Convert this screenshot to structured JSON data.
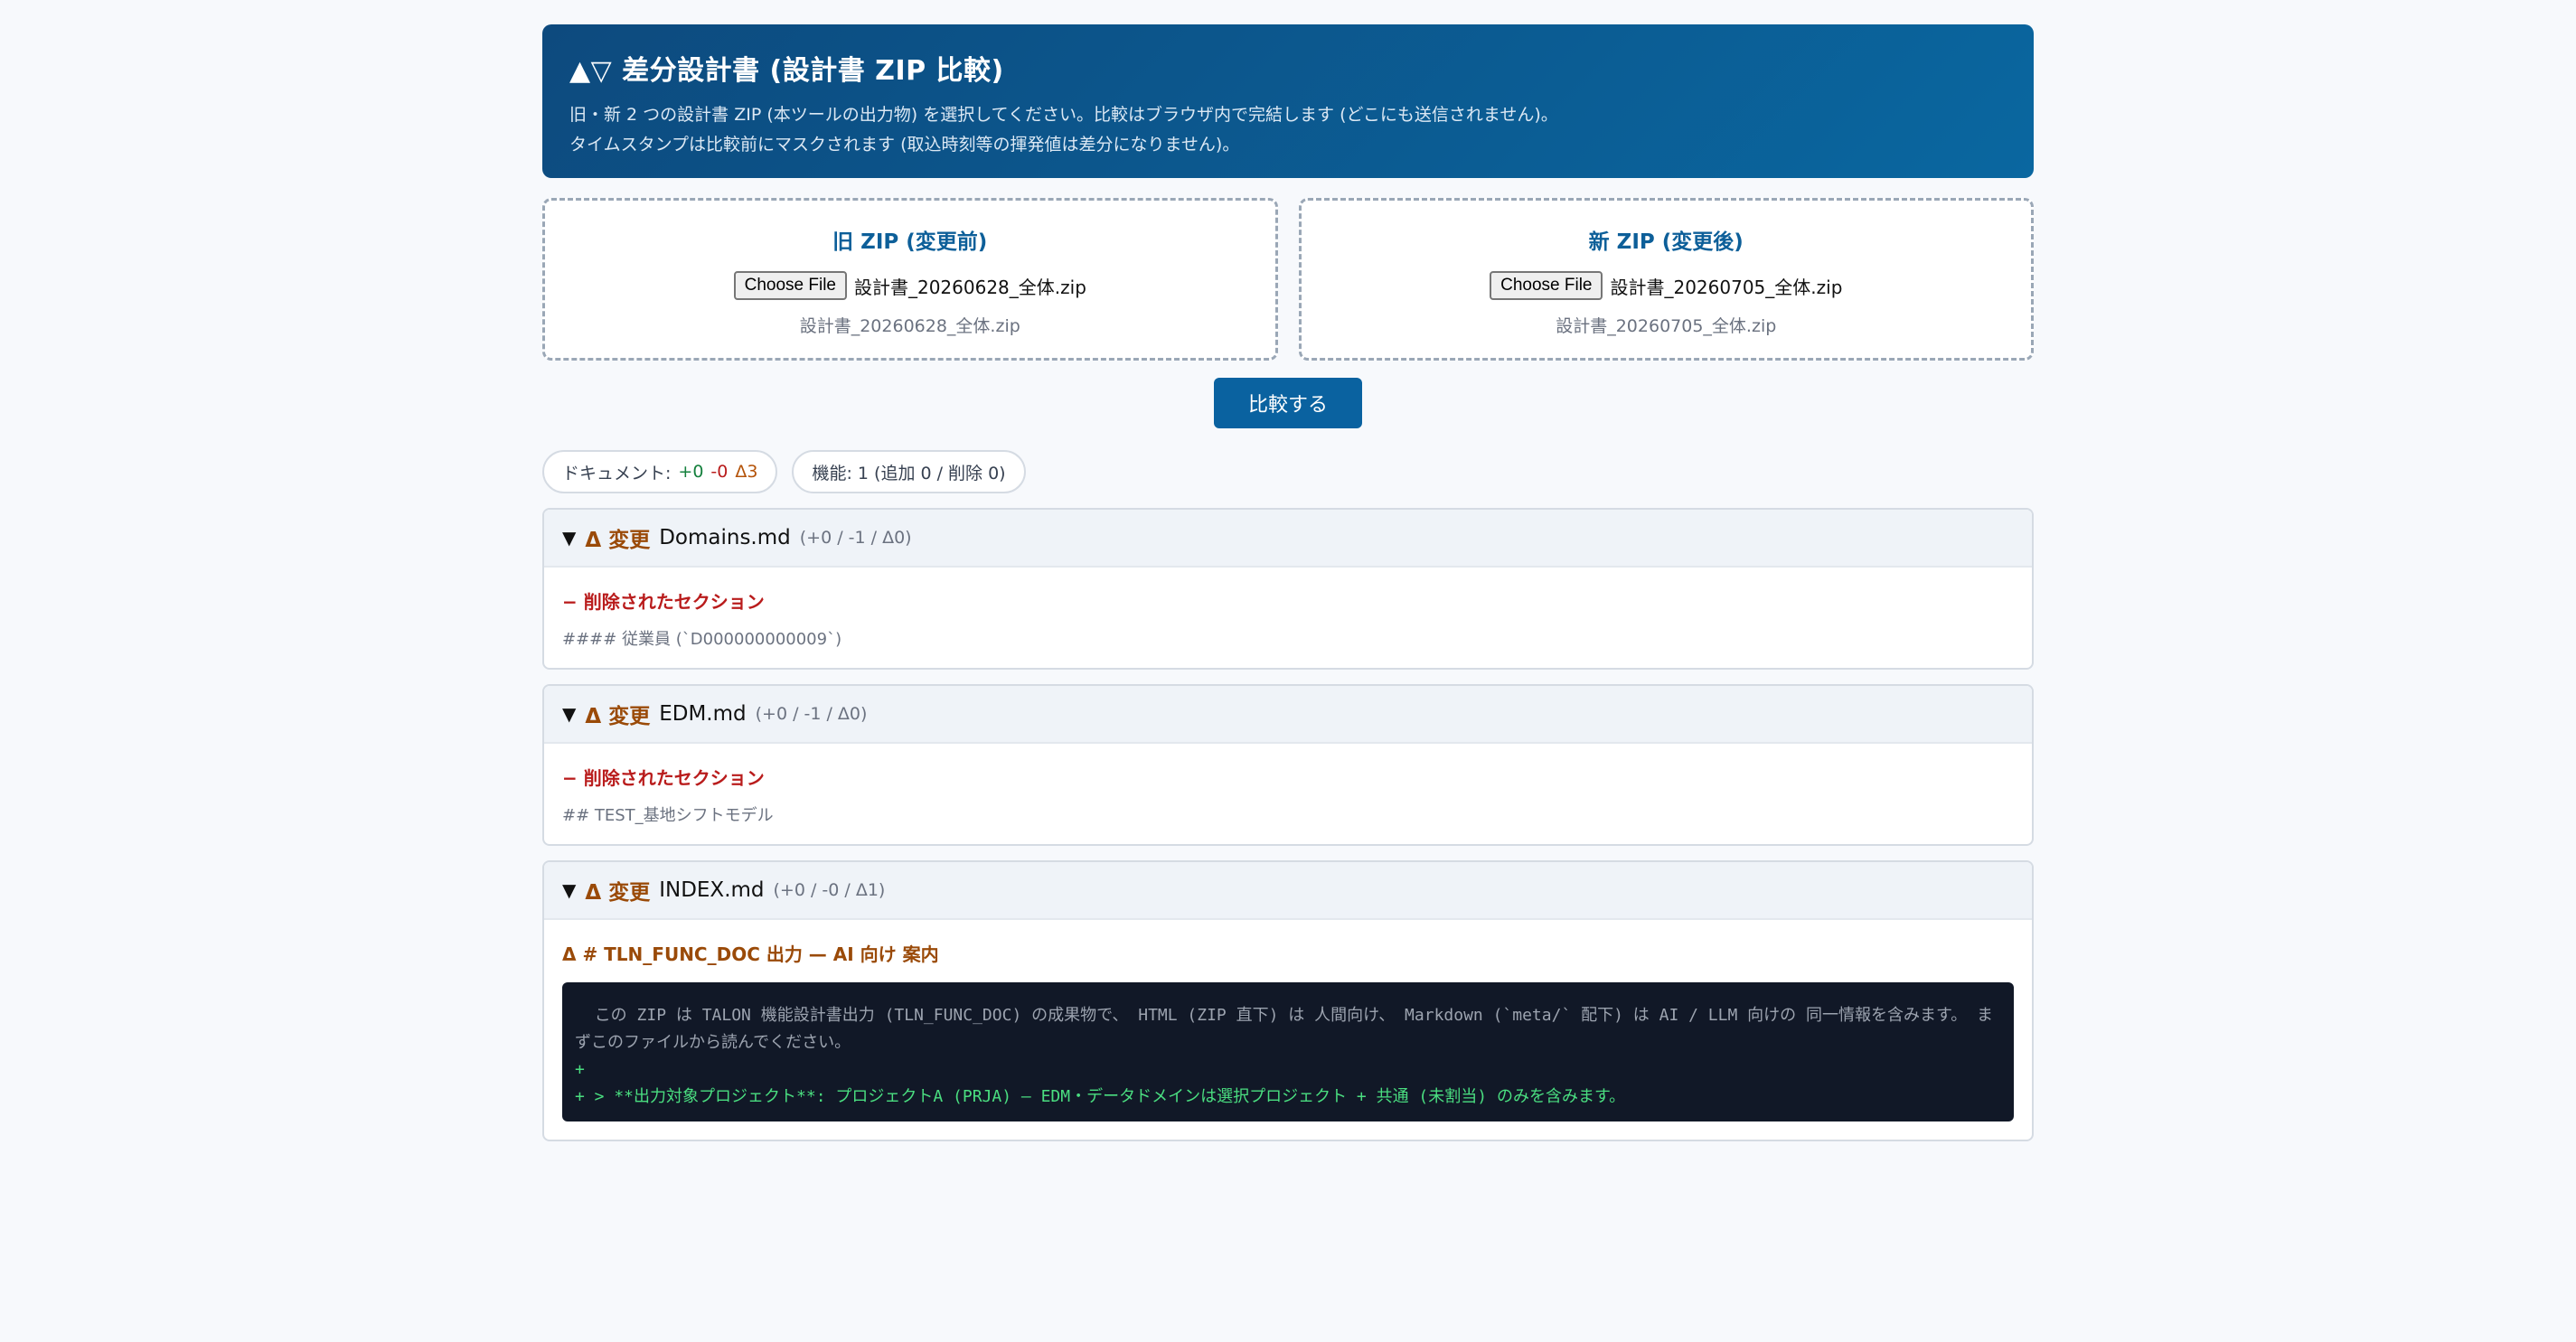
{
  "header": {
    "title": "▲▽ 差分設計書 (設計書 ZIP 比較)",
    "desc1": "旧・新 2 つの設計書 ZIP (本ツールの出力物) を選択してください。比較はブラウザ内で完結します (どこにも送信されません)。",
    "desc2": "タイムスタンプは比較前にマスクされます (取込時刻等の揮発値は差分になりません)。"
  },
  "old_zip": {
    "title": "旧 ZIP (変更前)",
    "button": "Choose File",
    "filename": "設計書_20260628_全体.zip",
    "label": "設計書_20260628_全体.zip"
  },
  "new_zip": {
    "title": "新 ZIP (変更後)",
    "button": "Choose File",
    "filename": "設計書_20260705_全体.zip",
    "label": "設計書_20260705_全体.zip"
  },
  "compare_button": "比較する",
  "summary": {
    "docs_label": "ドキュメント:",
    "docs_plus": "+0",
    "docs_minus": "-0",
    "docs_delta": "Δ3",
    "features": "機能: 1 (追加 0 / 削除 0)"
  },
  "files": [
    {
      "toggle": "▼",
      "kind": "Δ 変更",
      "name": "Domains.md",
      "stats": "(+0 / -1 / Δ0)",
      "section_title": "− 削除されたセクション",
      "section_line": "#### 従業員 (`D000000000009`)"
    },
    {
      "toggle": "▼",
      "kind": "Δ 変更",
      "name": "EDM.md",
      "stats": "(+0 / -1 / Δ0)",
      "section_title": "− 削除されたセクション",
      "section_line": "## TEST_基地シフトモデル"
    },
    {
      "toggle": "▼",
      "kind": "Δ 変更",
      "name": "INDEX.md",
      "stats": "(+0 / -0 / Δ1)",
      "section_title": "Δ # TLN_FUNC_DOC 出力 — AI 向け 案内",
      "code_context": "  この ZIP は TALON 機能設計書出力 (TLN_FUNC_DOC) の成果物で、 HTML (ZIP 直下) は 人間向け、 Markdown (`meta/` 配下) は AI / LLM 向けの 同一情報を含みます。 まずこのファイルから読んでください。",
      "code_add1": "+",
      "code_add2": "+ > **出力対象プロジェクト**: プロジェクトA (PRJA) — EDM・データドメインは選択プロジェクト + 共通 (未割当) のみを含みます。"
    }
  ]
}
